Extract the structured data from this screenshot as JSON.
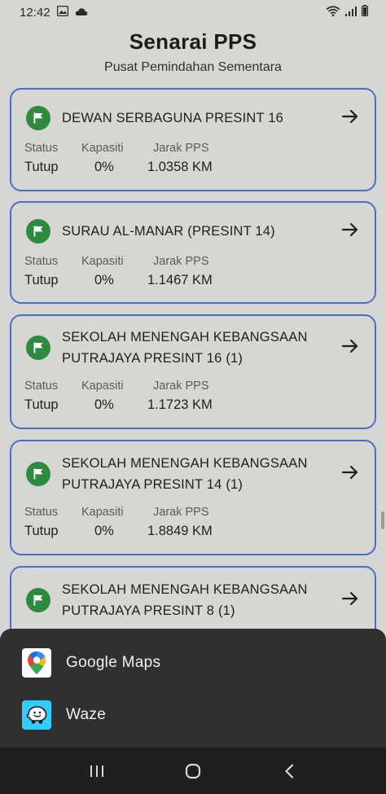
{
  "status_bar": {
    "time": "12:42"
  },
  "header": {
    "title": "Senarai PPS",
    "subtitle": "Pusat Pemindahan Sementara"
  },
  "labels": {
    "status": "Status",
    "capacity": "Kapasiti",
    "distance": "Jarak PPS"
  },
  "cards": [
    {
      "name": "DEWAN SERBAGUNA PRESINT 16",
      "status": "Tutup",
      "capacity": "0%",
      "distance": "1.0358 KM"
    },
    {
      "name": "SURAU AL-MANAR (PRESINT 14)",
      "status": "Tutup",
      "capacity": "0%",
      "distance": "1.1467 KM"
    },
    {
      "name": "SEKOLAH MENENGAH KEBANGSAAN PUTRAJAYA PRESINT 16 (1)",
      "status": "Tutup",
      "capacity": "0%",
      "distance": "1.1723 KM"
    },
    {
      "name": "SEKOLAH MENENGAH KEBANGSAAN PUTRAJAYA PRESINT 14 (1)",
      "status": "Tutup",
      "capacity": "0%",
      "distance": "1.8849 KM"
    },
    {
      "name": "SEKOLAH MENENGAH KEBANGSAAN PUTRAJAYA PRESINT 8 (1)"
    }
  ],
  "sheet": {
    "items": [
      {
        "label": "Google Maps",
        "icon": "google-maps-icon"
      },
      {
        "label": "Waze",
        "icon": "waze-icon"
      }
    ]
  },
  "colors": {
    "card_border": "#4a6fc4",
    "flag_green": "#2e8b3e",
    "sheet_bg": "#303030",
    "waze_blue": "#33ccff"
  }
}
